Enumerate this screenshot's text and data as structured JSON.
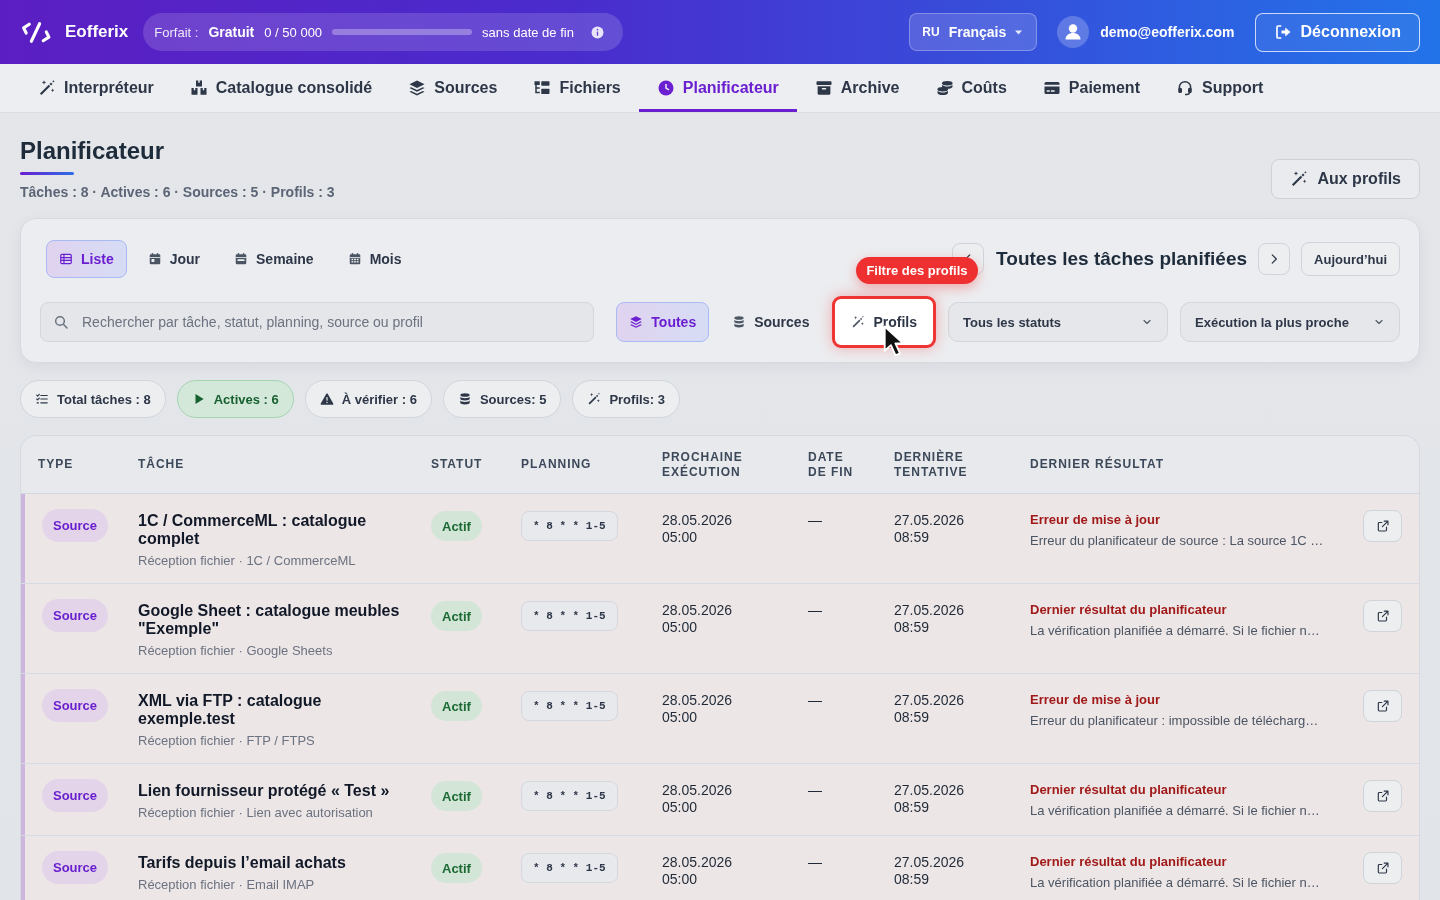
{
  "top_bar": {
    "brand": "Eofferix",
    "plan": {
      "label": "Forfait :",
      "name": "Gratuit",
      "usage": "0 / 50 000",
      "level": 0,
      "expiry": "sans date de fin"
    },
    "language": {
      "code": "RU",
      "name": "Français"
    },
    "user_email": "demo@eofferix.com",
    "logout": "Déconnexion"
  },
  "nav": [
    {
      "label": "Interpréteur",
      "selected": false
    },
    {
      "label": "Catalogue consolidé",
      "selected": false
    },
    {
      "label": "Sources",
      "selected": false
    },
    {
      "label": "Fichiers",
      "selected": false
    },
    {
      "label": "Planificateur",
      "selected": true
    },
    {
      "label": "Archive",
      "selected": false
    },
    {
      "label": "Coûts",
      "selected": false
    },
    {
      "label": "Paiement",
      "selected": false
    },
    {
      "label": "Support",
      "selected": false
    }
  ],
  "page": {
    "title": "Planificateur",
    "summary": "Tâches : 8 · Actives : 6 · Sources : 5 · Profils : 3",
    "action": "Aux profils"
  },
  "toolbar": {
    "views": [
      {
        "label": "Liste",
        "selected": true
      },
      {
        "label": "Jour",
        "selected": false
      },
      {
        "label": "Semaine",
        "selected": false
      },
      {
        "label": "Mois",
        "selected": false
      }
    ],
    "period_title": "Toutes les tâches planifiées",
    "today": "Aujourd’hui",
    "search": {
      "placeholder": "Rechercher par tâche, statut, planning, source ou profil"
    },
    "filters": [
      {
        "label": "Toutes",
        "selected": true,
        "highlighted": false
      },
      {
        "label": "Sources",
        "selected": false,
        "highlighted": false
      },
      {
        "label": "Profils",
        "selected": false,
        "highlighted": true,
        "tooltip": "Filtre des profils"
      }
    ],
    "selects": [
      {
        "value": "Tous les statuts"
      },
      {
        "value": "Exécution la plus proche"
      }
    ]
  },
  "stats": [
    {
      "label": "Total tâches : 8",
      "kind": "neutral"
    },
    {
      "label": "Actives : 6",
      "kind": "success"
    },
    {
      "label": "À vérifier : 6",
      "kind": "neutral"
    },
    {
      "label": "Sources: 5",
      "kind": "neutral"
    },
    {
      "label": "Profils: 3",
      "kind": "neutral"
    }
  ],
  "table": {
    "columns": [
      "TYPE",
      "TÂCHE",
      "STATUT",
      "PLANNING",
      "PROCHAINE EXÉCUTION",
      "DATE DE FIN",
      "DERNIÈRE TENTATIVE",
      "DERNIER RÉSULTAT"
    ],
    "rows": [
      {
        "type": "Source",
        "title": "1C / CommerceML : catalogue complet",
        "source": "Réception fichier · 1C / CommerceML",
        "status": "Actif",
        "schedule": "* 8 * * 1-5",
        "next_run": "28.05.2026 05:00",
        "end_date": "—",
        "last_attempt": "27.05.2026 08:59",
        "result_title": "Erreur de mise à jour",
        "result_detail": "Erreur du planificateur de source : La source 1C …"
      },
      {
        "type": "Source",
        "title": "Google Sheet : catalogue meubles \"Exemple\"",
        "source": "Réception fichier · Google Sheets",
        "status": "Actif",
        "schedule": "* 8 * * 1-5",
        "next_run": "28.05.2026 05:00",
        "end_date": "—",
        "last_attempt": "27.05.2026 08:59",
        "result_title": "Dernier résultat du planificateur",
        "result_detail": "La vérification planifiée a démarré. Si le fichier n…"
      },
      {
        "type": "Source",
        "title": "XML via FTP : catalogue exemple.test",
        "source": "Réception fichier · FTP / FTPS",
        "status": "Actif",
        "schedule": "* 8 * * 1-5",
        "next_run": "28.05.2026 05:00",
        "end_date": "—",
        "last_attempt": "27.05.2026 08:59",
        "result_title": "Erreur de mise à jour",
        "result_detail": "Erreur du planificateur : impossible de télécharg…"
      },
      {
        "type": "Source",
        "title": "Lien fournisseur protégé « Test »",
        "source": "Réception fichier · Lien avec autorisation",
        "status": "Actif",
        "schedule": "* 8 * * 1-5",
        "next_run": "28.05.2026 05:00",
        "end_date": "—",
        "last_attempt": "27.05.2026 08:59",
        "result_title": "Dernier résultat du planificateur",
        "result_detail": "La vérification planifiée a démarré. Si le fichier n…"
      },
      {
        "type": "Source",
        "title": "Tarifs depuis l’email achats",
        "source": "Réception fichier · Email IMAP",
        "status": "Actif",
        "schedule": "* 8 * * 1-5",
        "next_run": "28.05.2026 05:00",
        "end_date": "—",
        "last_attempt": "27.05.2026 08:59",
        "result_title": "Dernier résultat du planificateur",
        "result_detail": "La vérification planifiée a démarré. Si le fichier n…"
      }
    ]
  }
}
